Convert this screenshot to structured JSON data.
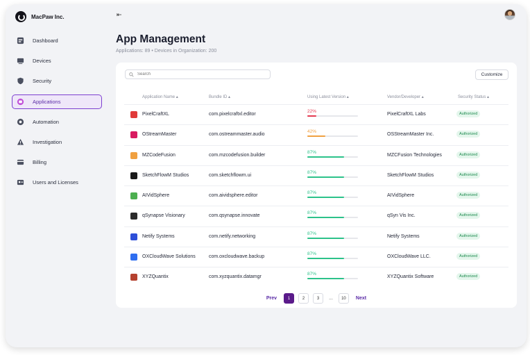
{
  "app": {
    "brand": "MacPaw Inc."
  },
  "sidebar": {
    "items": [
      {
        "label": "Dashboard",
        "icon": "dashboard-icon",
        "active": false
      },
      {
        "label": "Devices",
        "icon": "devices-icon",
        "active": false
      },
      {
        "label": "Security",
        "icon": "shield-icon",
        "active": false
      },
      {
        "label": "Applications",
        "icon": "applications-icon",
        "active": true
      },
      {
        "label": "Automation",
        "icon": "automation-icon",
        "active": false
      },
      {
        "label": "Investigation",
        "icon": "investigation-icon",
        "active": false
      },
      {
        "label": "Billing",
        "icon": "billing-icon",
        "active": false
      },
      {
        "label": "Users and Licenses",
        "icon": "users-icon",
        "active": false
      }
    ]
  },
  "header": {
    "title": "App Management",
    "subtitle": "Applications: 89 • Devices in Organization: 200"
  },
  "toolbar": {
    "search_placeholder": "Search",
    "customize_label": "Customize"
  },
  "table": {
    "columns": [
      "Application Name",
      "Bundle ID",
      "Using Latest Version",
      "Vendor/Developer",
      "Security Status"
    ],
    "rows": [
      {
        "name": "PixelCraftXL",
        "bundle": "com.pixelcraftxl.editor",
        "pct_label": "22%",
        "pct": 22,
        "vendor": "PixelCraftXL Labs",
        "status": "Authorized",
        "icon_color": "#e03a3a"
      },
      {
        "name": "OStreamMaster",
        "bundle": "com.ostreammaster.audio",
        "pct_label": "42%",
        "pct": 42,
        "vendor": "OSStreamMaster Inc.",
        "status": "Authorized",
        "icon_color": "#d81b60"
      },
      {
        "name": "MZCodeFusion",
        "bundle": "com.mzcodefusion.builder",
        "pct_label": "87%",
        "pct": 87,
        "vendor": "MZCFusion Technologies",
        "status": "Authorized",
        "icon_color": "#f0a040"
      },
      {
        "name": "SketchFlowM Studios",
        "bundle": "com.sketchflowm.ui",
        "pct_label": "87%",
        "pct": 87,
        "vendor": "SketchFlowM Studios",
        "status": "Authorized",
        "icon_color": "#1a1a1a"
      },
      {
        "name": "AIVidSphere",
        "bundle": "com.aividsphere.editor",
        "pct_label": "87%",
        "pct": 87,
        "vendor": "AIVidSphere",
        "status": "Authorized",
        "icon_color": "#4caf50"
      },
      {
        "name": "qSynapse Visionary",
        "bundle": "com.qsynapse.innovate",
        "pct_label": "87%",
        "pct": 87,
        "vendor": "qSyn Vis Inc.",
        "status": "Authorized",
        "icon_color": "#2b2b2b"
      },
      {
        "name": "Netify Systems",
        "bundle": "com.netify.networking",
        "pct_label": "87%",
        "pct": 87,
        "vendor": "Netify Systems",
        "status": "Authorized",
        "icon_color": "#2d4fd8"
      },
      {
        "name": "OXCloudWave Solutions",
        "bundle": "com.oxcloudwave.backup",
        "pct_label": "87%",
        "pct": 87,
        "vendor": "OXCloudWave LLC.",
        "status": "Authorized",
        "icon_color": "#2f6ef0"
      },
      {
        "name": "XYZQuantix",
        "bundle": "com.xyzquantix.datamgr",
        "pct_label": "87%",
        "pct": 87,
        "vendor": "XYZQuantix Software",
        "status": "Authorized",
        "icon_color": "#b5412f"
      }
    ]
  },
  "pagination": {
    "prev": "Prev",
    "next": "Next",
    "pages": [
      "1",
      "2",
      "3"
    ],
    "ellipsis": "...",
    "last": "10",
    "current": "1"
  },
  "colors": {
    "accent": "#5a1a8a",
    "low": "#e53950",
    "mid": "#f0a040",
    "high": "#2cc28a"
  }
}
